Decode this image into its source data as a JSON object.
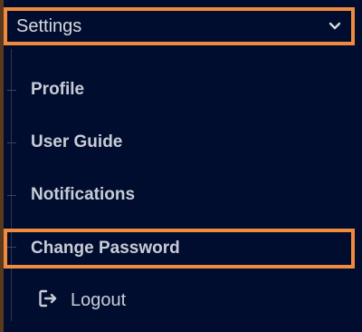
{
  "menu": {
    "header": {
      "label": "Settings",
      "chevron_icon": "chevron-down-icon"
    },
    "items": [
      {
        "label": "Profile"
      },
      {
        "label": "User Guide"
      },
      {
        "label": "Notifications"
      },
      {
        "label": "Change Password"
      }
    ],
    "logout": {
      "label": "Logout",
      "icon": "logout-icon"
    }
  },
  "colors": {
    "panel_bg": "#000d2e",
    "highlight_border": "#f08a3c",
    "text": "#c8ccd6"
  }
}
